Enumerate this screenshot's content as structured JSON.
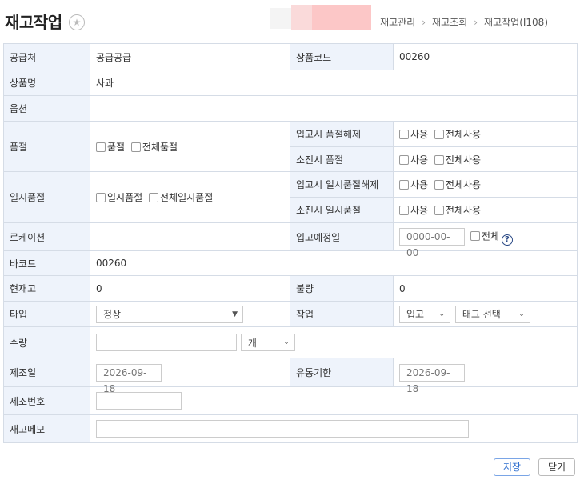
{
  "header": {
    "title": "재고작업",
    "breadcrumb": [
      "재고관리",
      "재고조회",
      "재고작업(I108)"
    ]
  },
  "fields": {
    "supplier": {
      "label": "공급처",
      "value": "공급공급"
    },
    "product_code": {
      "label": "상품코드",
      "value": "00260"
    },
    "product_name": {
      "label": "상품명",
      "value": "사과"
    },
    "option": {
      "label": "옵션",
      "value": ""
    },
    "soldout": {
      "label": "품절",
      "cb1": "품절",
      "cb2": "전체품절"
    },
    "soldout_release_in": {
      "label": "입고시 품절해제",
      "cb1": "사용",
      "cb2": "전체사용"
    },
    "soldout_on_exhaust": {
      "label": "소진시 품절",
      "cb1": "사용",
      "cb2": "전체사용"
    },
    "temp_soldout": {
      "label": "일시품절",
      "cb1": "일시품절",
      "cb2": "전체일시품절"
    },
    "temp_release_in": {
      "label": "입고시 일시품절해제",
      "cb1": "사용",
      "cb2": "전체사용"
    },
    "temp_on_exhaust": {
      "label": "소진시 일시품절",
      "cb1": "사용",
      "cb2": "전체사용"
    },
    "location": {
      "label": "로케이션",
      "value": ""
    },
    "expected_date": {
      "label": "입고예정일",
      "placeholder": "0000-00-00",
      "cb": "전체"
    },
    "barcode": {
      "label": "바코드",
      "value": "00260"
    },
    "current_stock": {
      "label": "현재고",
      "value": "0"
    },
    "defect": {
      "label": "불량",
      "value": "0"
    },
    "type": {
      "label": "타입",
      "selected": "정상"
    },
    "work": {
      "label": "작업",
      "selected": "입고",
      "tag_selected": "태그 선택"
    },
    "quantity": {
      "label": "수량",
      "value": "",
      "unit": "개"
    },
    "mfg_date": {
      "label": "제조일",
      "value": "2026-09-18"
    },
    "expiry_date": {
      "label": "유통기한",
      "value": "2026-09-18"
    },
    "mfg_number": {
      "label": "제조번호",
      "value": ""
    },
    "memo": {
      "label": "재고메모",
      "value": ""
    }
  },
  "buttons": {
    "save": "저장",
    "close": "닫기"
  },
  "icons": {
    "star": "star-icon",
    "help": "help-icon"
  },
  "colors": {
    "label_bg": "#eef3fb",
    "border": "#d5dce6",
    "save_text": "#2f6fcf"
  }
}
